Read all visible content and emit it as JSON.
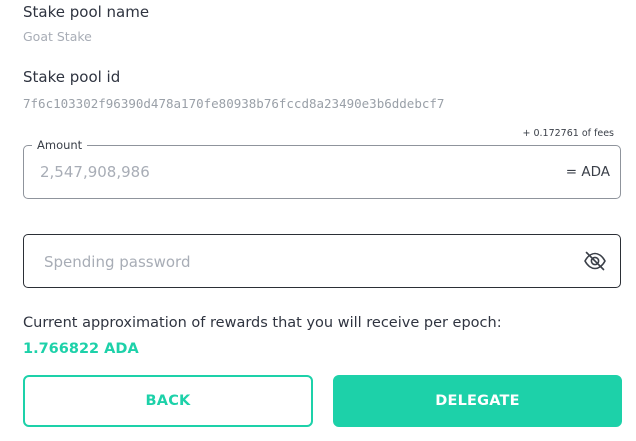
{
  "pool": {
    "name_label": "Stake pool name",
    "name_value": "Goat Stake",
    "id_label": "Stake pool id",
    "id_value": "7f6c103302f96390d478a170fe80938b76fccd8a23490e3b6ddebcf7"
  },
  "amount": {
    "fees_note": "+ 0.172761 of fees",
    "label": "Amount",
    "value": "2,547,908,986",
    "unit": "= ADA"
  },
  "password": {
    "placeholder": "Spending password",
    "value": "",
    "visibility_icon": "eye-off-icon"
  },
  "rewards": {
    "text": "Current approximation of rewards that you will receive per epoch:",
    "value": "1.766822 ADA"
  },
  "buttons": {
    "back_label": "BACK",
    "delegate_label": "DELEGATE"
  },
  "colors": {
    "accent": "#1dd1a9",
    "text_primary": "#2f3440",
    "text_muted": "#a8adb6"
  }
}
